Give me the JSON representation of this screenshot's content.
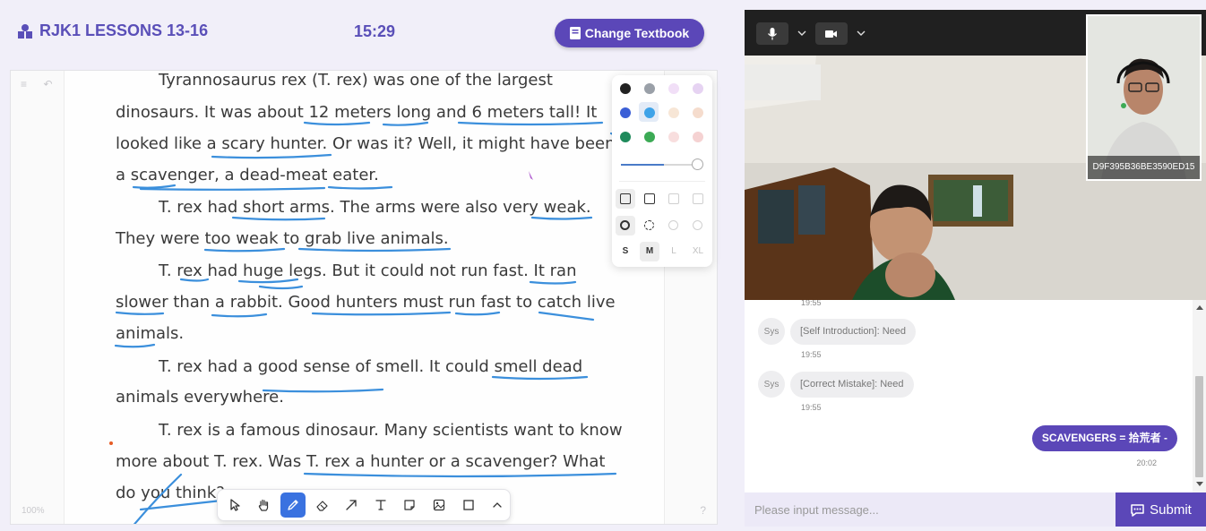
{
  "header": {
    "title": "RJK1 LESSONS 13-16",
    "timer": "15:29",
    "change_textbook_label": "Change Textbook"
  },
  "board": {
    "zoom": "100%",
    "help": "?",
    "passage": [
      "Tyrannosaurus rex (T. rex) was one of the largest",
      "dinosaurs. It was about 12 meters long and 6 meters tall! It",
      "looked like a scary hunter. Or was it? Well, it might have been",
      "a scavenger, a dead-meat eater.",
      "T. rex had short arms. The arms were also very weak.",
      "They were too weak to grab live animals.",
      "T. rex had huge legs. But it could not run fast. It ran",
      "slower than a rabbit. Good hunters must run fast to catch live",
      "animals.",
      "T. rex had a good sense of smell. It could smell dead",
      "animals everywhere.",
      "T. rex is a famous dinosaur. Many scientists want to know",
      "more about T. rex. Was T. rex a hunter or a scavenger? What",
      "do you think?"
    ]
  },
  "palette": {
    "colors": [
      "#222222",
      "#9aa0a8",
      "#f1dff7",
      "#e6d3f2",
      "#3b5fd6",
      "#3fa3e8",
      "#f7e6d6",
      "#f5dccd",
      "#1f8a5b",
      "#3caa55",
      "#f8dede",
      "#f5d2d2"
    ],
    "sizes": [
      "S",
      "M",
      "L",
      "XL"
    ],
    "selected_size": "M",
    "stroke_width": 0.6
  },
  "toolbar": {
    "tools": [
      "select-icon",
      "hand-icon",
      "pen-icon",
      "eraser-icon",
      "arrow-icon",
      "text-icon",
      "sticky-note-icon",
      "image-icon",
      "rectangle-icon",
      "chevron-up-icon"
    ],
    "active": "pen-icon"
  },
  "video": {
    "self_cam_id": "D9F395B36BE3590ED15"
  },
  "chat": {
    "messages": [
      {
        "sender": "Sys",
        "text": "[Self Introduction]: Need",
        "time": "19:55"
      },
      {
        "sender": "Sys",
        "text": "[Correct Mistake]: Need",
        "time": "19:55"
      },
      {
        "sender": "me",
        "text": "SCAVENGERS = 拾荒者 -",
        "time": "20:02"
      }
    ],
    "prev_time": "19:55",
    "input_placeholder": "Please input message...",
    "submit_label": "Submit"
  }
}
